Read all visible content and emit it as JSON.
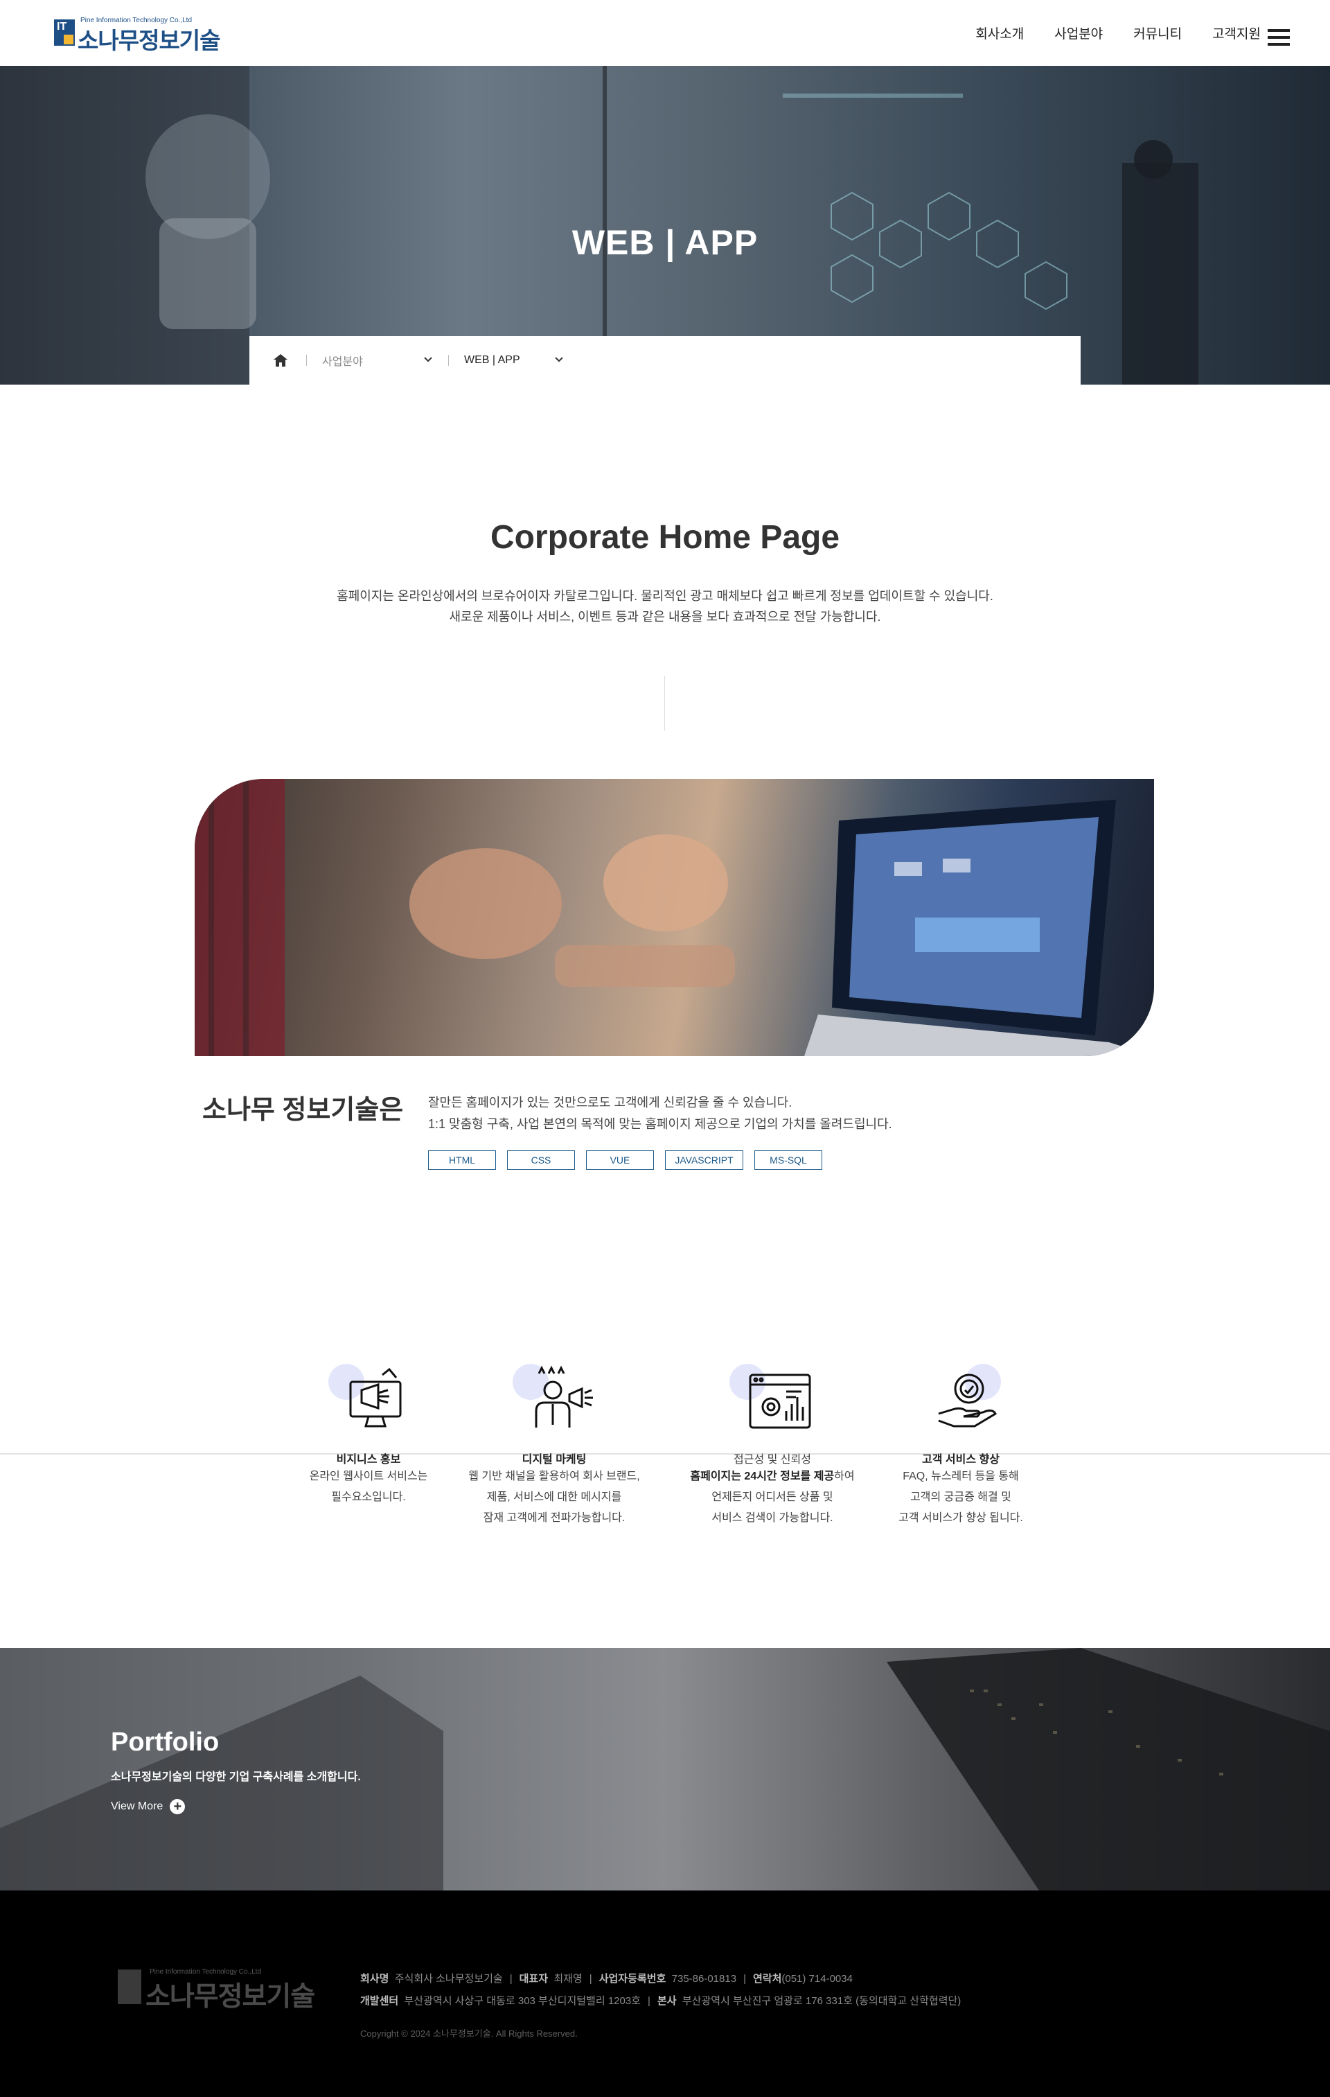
{
  "header": {
    "logo_eng": "Pine Information Technology Co.,Ltd",
    "logo_kor": "소나무정보기술",
    "logo_mark": "IT",
    "nav": [
      "회사소개",
      "사업분야",
      "커뮤니티",
      "고객지원"
    ],
    "menu_icon": "hamburger-icon"
  },
  "hero": {
    "title": "WEB | APP"
  },
  "breadcrumb": {
    "home_icon": "home-icon",
    "level1": "사업분야",
    "level2": "WEB | APP"
  },
  "intro": {
    "title": "Corporate Home Page",
    "line1": "홈페이지는 온라인상에서의 브로슈어이자 카탈로그입니다. 물리적인 광고 매체보다 쉽고 빠르게 정보를 업데이트할 수 있습니다.",
    "line2": "새로운 제품이나 서비스, 이벤트 등과 같은 내용을 보다 효과적으로 전달 가능합니다."
  },
  "about": {
    "title": "소나무 정보기술은",
    "line1": "잘만든 홈페이지가 있는 것만으로도 고객에게 신뢰감을 줄 수 있습니다.",
    "line2": "1:1 맞춤형 구축, 사업 본연의 목적에 맞는 홈페이지 제공으로 기업의 가치를 올려드립니다.",
    "tags": [
      "HTML",
      "CSS",
      "VUE",
      "JAVASCRIPT",
      "MS-SQL"
    ]
  },
  "features": [
    {
      "icon": "monitor-megaphone-icon",
      "title": "비지니스 홍보",
      "lines": [
        "온라인 웹사이트 서비스는",
        "필수요소입니다."
      ]
    },
    {
      "icon": "marketer-megaphone-icon",
      "title": "디지털 마케팅",
      "lines": [
        "웹 기반 채널을 활용하여 회사 브랜드,",
        "제품, 서비스에 대한 메시지를",
        "잠재 고객에게 전파가능합니다."
      ]
    },
    {
      "icon": "browser-analytics-icon",
      "title": "접근성 및 신뢰성",
      "bold": "홈페이지는 24시간 정보를 제공",
      "bold_tail": "하여",
      "lines": [
        "언제든지 어디서든 상품 및",
        "서비스 검색이 가능합니다."
      ]
    },
    {
      "icon": "hand-badge-icon",
      "title": "고객 서비스 향상",
      "lines": [
        "FAQ, 뉴스레터 등을 통해",
        "고객의 궁금증 해결 및",
        "고객 서비스가 향상 됩니다."
      ]
    }
  ],
  "portfolio": {
    "title": "Portfolio",
    "subtitle": "소나무정보기술의 다양한 기업 구축사례를 소개합니다.",
    "more": "View More"
  },
  "footer": {
    "logo_eng": "Pine Information Technology Co.,Ltd",
    "logo_kor": "소나무정보기술",
    "company_label": "회사명",
    "company": "주식회사 소나무정보기술",
    "ceo_label": "대표자",
    "ceo": "최재영",
    "bizno_label": "사업자등록번호",
    "bizno": "735-86-01813",
    "contact_label": "연락처",
    "contact": "(051) 714-0034",
    "dev_label": "개발센터",
    "dev_addr": "부산광역시 사상구 대동로 303 부산디지털밸리 1203호",
    "hq_label": "본사",
    "hq_addr": "부산광역시 부산진구 엄광로 176 331호 (동의대학교 산학협력단)",
    "copyright": "Copyright © 2024 소나무정보기술. All Rights Reserved."
  }
}
